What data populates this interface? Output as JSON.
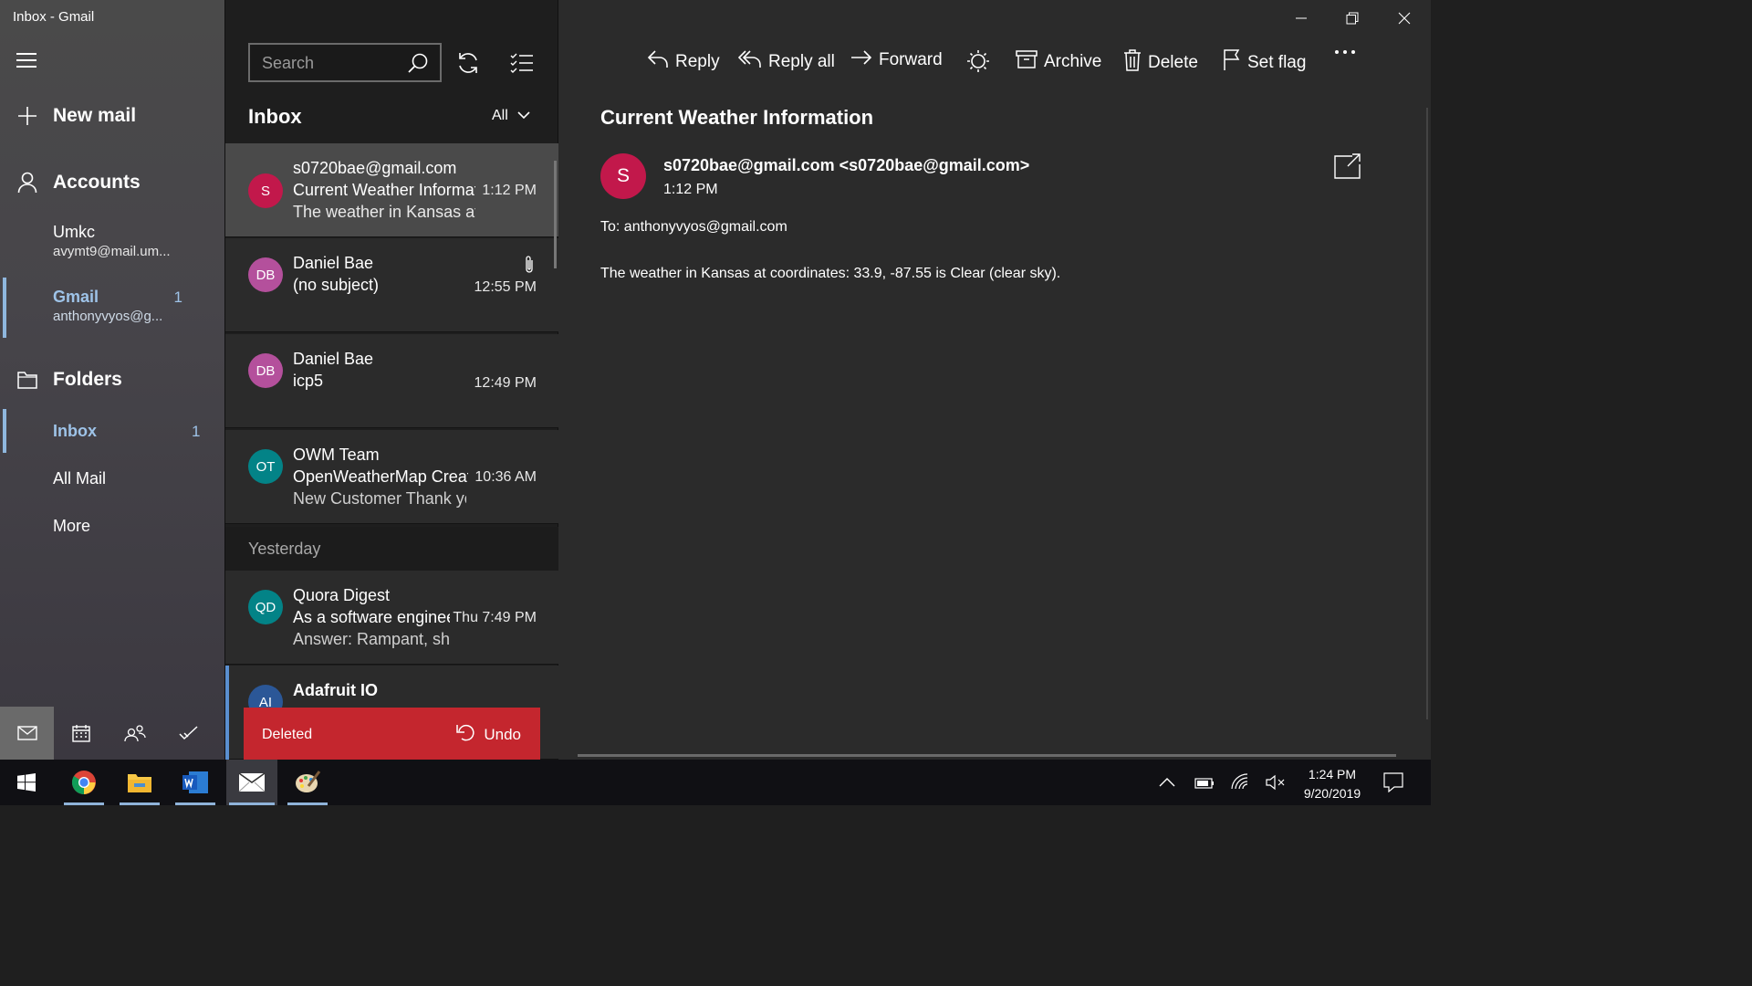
{
  "window": {
    "title": "Inbox - Gmail"
  },
  "sidebar": {
    "new_mail": "New mail",
    "accounts_label": "Accounts",
    "accounts": [
      {
        "name": "Umkc",
        "email": "avymt9@mail.um...",
        "count": ""
      },
      {
        "name": "Gmail",
        "email": "anthonyvyos@g...",
        "count": "1"
      }
    ],
    "folders_label": "Folders",
    "folders": [
      {
        "name": "Inbox",
        "count": "1"
      },
      {
        "name": "All Mail",
        "count": ""
      },
      {
        "name": "More",
        "count": ""
      }
    ],
    "bottom_nav": [
      "mail-icon",
      "calendar-icon",
      "people-icon",
      "todo-icon"
    ]
  },
  "list": {
    "search_placeholder": "Search",
    "title": "Inbox",
    "filter": "All",
    "group_yesterday": "Yesterday",
    "messages": [
      {
        "initials": "S",
        "avatar_color": "#c2184b",
        "from": "s0720bae@gmail.com",
        "subject": "Current Weather Information",
        "preview": "The weather in Kansas at coordinates",
        "time": "1:12 PM"
      },
      {
        "initials": "DB",
        "avatar_color": "#b4509c",
        "from": "Daniel Bae",
        "subject": "(no subject)",
        "preview": "",
        "time": "12:55 PM"
      },
      {
        "initials": "DB",
        "avatar_color": "#b4509c",
        "from": "Daniel Bae",
        "subject": "icp5",
        "preview": "",
        "time": "12:49 PM"
      },
      {
        "initials": "OT",
        "avatar_color": "#038387",
        "from": "OWM Team",
        "subject": "OpenWeatherMap Create",
        "preview": "New Customer Thank you",
        "time": "10:36 AM"
      },
      {
        "initials": "QD",
        "avatar_color": "#038387",
        "from": "Quora Digest",
        "subject": "As a software engineer",
        "preview": "Answer: Rampant, sh",
        "time": "Thu 7:49 PM"
      },
      {
        "initials": "AI",
        "avatar_color": "#2b5797",
        "from": "Adafruit IO",
        "subject": "",
        "preview": "",
        "time": ""
      }
    ],
    "toast": {
      "text": "Deleted",
      "undo": "Undo"
    }
  },
  "pane": {
    "commands": {
      "reply": "Reply",
      "reply_all": "Reply all",
      "forward": "Forward",
      "archive": "Archive",
      "delete": "Delete",
      "set_flag": "Set flag"
    },
    "subject": "Current Weather Information",
    "sender_initial": "S",
    "sender": "s0720bae@gmail.com <s0720bae@gmail.com>",
    "sent_time": "1:12 PM",
    "to": "To: anthonyvyos@gmail.com",
    "body": "The weather in Kansas at coordinates: 33.9, -87.55 is Clear (clear sky)."
  },
  "taskbar": {
    "time": "1:24 PM",
    "date": "9/20/2019"
  },
  "colors": {
    "accent": "#8fb7de",
    "toast": "#c4262e",
    "unread": "#5a8fd0"
  }
}
